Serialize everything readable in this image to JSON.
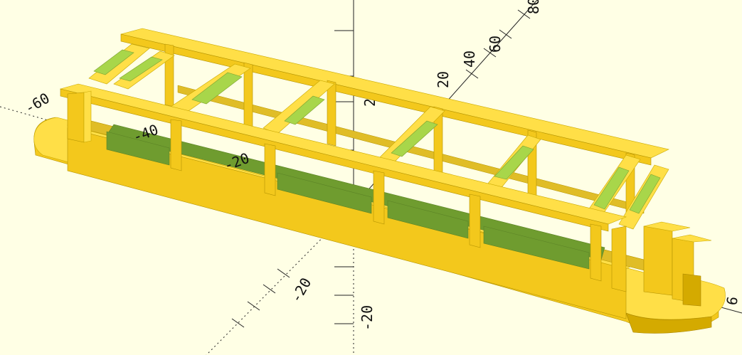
{
  "viewport": {
    "background": "#ffffe5",
    "model_color": "#f8d22a",
    "highlight_color": "#a8d64a"
  },
  "axis_labels": {
    "x_pos_20": "20",
    "x_pos_40": "40",
    "x_pos_60": "60",
    "x_pos_80": "80",
    "x_neg_20": "-20",
    "x_neg_40": "-40",
    "x_neg_60": "-60",
    "y_pos_20": "20",
    "y_neg_20": "-20",
    "z_neg_20": "-20",
    "x_edge": "6"
  }
}
